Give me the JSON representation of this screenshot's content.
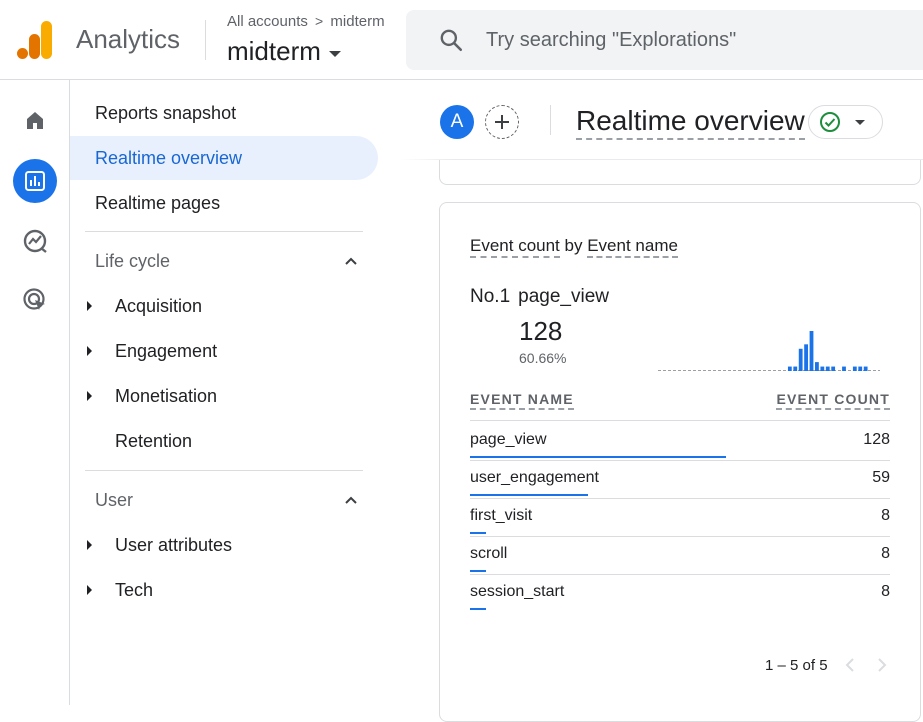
{
  "header": {
    "app_name": "Analytics",
    "breadcrumb_root": "All accounts",
    "breadcrumb_leaf": "midterm",
    "property_name": "midterm",
    "search_placeholder": "Try searching \"Explorations\""
  },
  "rail": {
    "items": [
      {
        "name": "home",
        "icon": "home-icon",
        "active": false
      },
      {
        "name": "reports",
        "icon": "bar-chart-icon",
        "active": true
      },
      {
        "name": "explore",
        "icon": "explore-icon",
        "active": false
      },
      {
        "name": "advertising",
        "icon": "advertising-icon",
        "active": false
      }
    ]
  },
  "nav": {
    "top_items": [
      "Reports snapshot",
      "Realtime overview",
      "Realtime pages"
    ],
    "active_item": "Realtime overview",
    "sections": [
      {
        "title": "Life cycle",
        "children": [
          {
            "label": "Acquisition",
            "expandable": true
          },
          {
            "label": "Engagement",
            "expandable": true
          },
          {
            "label": "Monetisation",
            "expandable": true
          },
          {
            "label": "Retention",
            "expandable": false
          }
        ]
      },
      {
        "title": "User",
        "children": [
          {
            "label": "User attributes",
            "expandable": true
          },
          {
            "label": "Tech",
            "expandable": true
          }
        ]
      }
    ]
  },
  "main": {
    "avatar_letter": "A",
    "page_title": "Realtime overview",
    "status": "ok"
  },
  "card": {
    "title_part1": "Event count",
    "title_by": "by",
    "title_part2": "Event name",
    "top_rank": "No.1",
    "top_event": "page_view",
    "top_value": "128",
    "top_pct": "60.66%",
    "columns": {
      "left": "EVENT NAME",
      "right": "EVENT COUNT"
    },
    "rows": [
      {
        "name": "page_view",
        "count": "128",
        "share": 1.0
      },
      {
        "name": "user_engagement",
        "count": "59",
        "share": 0.461
      },
      {
        "name": "first_visit",
        "count": "8",
        "share": 0.0625
      },
      {
        "name": "scroll",
        "count": "8",
        "share": 0.0625
      },
      {
        "name": "session_start",
        "count": "8",
        "share": 0.0625
      }
    ],
    "mini_chart_values": [
      0,
      0,
      0,
      0,
      0,
      0,
      0,
      0,
      0,
      0,
      0,
      0,
      0,
      0,
      0,
      0,
      0,
      0,
      0,
      0,
      0,
      0,
      0,
      0,
      1,
      1,
      5,
      6,
      9,
      2,
      1,
      1,
      1,
      0,
      1,
      0,
      1,
      1,
      1,
      0,
      0
    ],
    "pager_text": "1 – 5 of 5"
  },
  "colors": {
    "accent": "#1a73e8",
    "active_bg": "#e8f0fe",
    "logo_orange": "#f9ab00",
    "logo_dark_orange": "#e37400",
    "success": "#1e8e3e"
  }
}
